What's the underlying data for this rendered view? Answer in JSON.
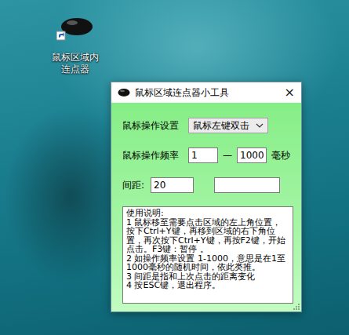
{
  "desktop_icon": {
    "label": "鼠标区域内连点器"
  },
  "window": {
    "title": "鼠标区域连点器小工具",
    "close": "×"
  },
  "mode": {
    "label": "鼠标操作设置",
    "value": "鼠标左键双击"
  },
  "frequency": {
    "label": "鼠标操作频率",
    "min": "1",
    "separator": "—",
    "max": "1000",
    "unit": "毫秒"
  },
  "spacing": {
    "label": "间距:",
    "value": "20",
    "extra": ""
  },
  "instructions": [
    "使用说明:",
    "1 鼠标移至需要点击区域的左上角位置，按下Ctrl+Y键，再移到区域的右下角位置，再次按下Ctrl+Y键，再按F2键，开始点击。F3键：暂停 。",
    "2 如操作频率设置 1-1000，意思是在1至1000毫秒的随机时间，依此类推。",
    "3 间距是指和上次点击的距离变化",
    "4 按ESC键，退出程序。"
  ]
}
